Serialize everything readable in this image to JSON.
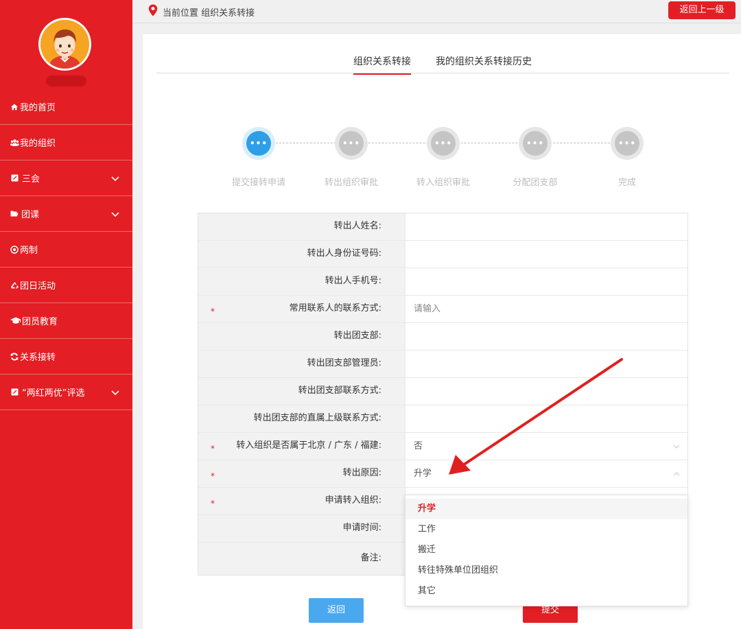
{
  "sidebar": {
    "items": [
      {
        "label": "我的首页",
        "icon": "home-icon",
        "has_chevron": false
      },
      {
        "label": "我的组织",
        "icon": "users-icon",
        "has_chevron": false
      },
      {
        "label": "三会",
        "icon": "edit-icon",
        "has_chevron": true
      },
      {
        "label": "团课",
        "icon": "folder-icon",
        "has_chevron": true
      },
      {
        "label": "两制",
        "icon": "target-icon",
        "has_chevron": false
      },
      {
        "label": "团日活动",
        "icon": "recycle-icon",
        "has_chevron": false
      },
      {
        "label": "团员教育",
        "icon": "graduation-cap-icon",
        "has_chevron": false
      },
      {
        "label": "关系接转",
        "icon": "refresh-icon",
        "has_chevron": false
      },
      {
        "label": "“两红两优”评选",
        "icon": "edit-icon",
        "has_chevron": true
      }
    ]
  },
  "topbar": {
    "location": "当前位置 组织关系转接",
    "back_button": "返回上一级"
  },
  "tabs": [
    {
      "label": "组织关系转接",
      "active": true
    },
    {
      "label": "我的组织关系转接历史",
      "active": false
    }
  ],
  "steps": [
    {
      "label": "提交接转申请",
      "active": true
    },
    {
      "label": "转出组织审批",
      "active": false
    },
    {
      "label": "转入组织审批",
      "active": false
    },
    {
      "label": "分配团支部",
      "active": false
    },
    {
      "label": "完成",
      "active": false
    }
  ],
  "step_circle_text": "•••",
  "form": {
    "required_mark": "*",
    "rows": [
      {
        "label": "转出人姓名:",
        "value": "",
        "required": false
      },
      {
        "label": "转出人身份证号码:",
        "value": "",
        "required": false
      },
      {
        "label": "转出人手机号:",
        "value": "",
        "required": false
      },
      {
        "label": "常用联系人的联系方式:",
        "value": "",
        "placeholder": "请输入",
        "required": true
      },
      {
        "label": "转出团支部:",
        "value": "",
        "required": false
      },
      {
        "label": "转出团支部管理员:",
        "value": "",
        "required": false
      },
      {
        "label": "转出团支部联系方式:",
        "value": "",
        "required": false
      },
      {
        "label": "转出团支部的直属上级联系方式:",
        "value": "",
        "required": false
      },
      {
        "label": "转入组织是否属于北京 / 广东 / 福建:",
        "value": "否",
        "required": true,
        "select": "down"
      },
      {
        "label": "转出原因:",
        "value": "升学",
        "required": true,
        "select": "up"
      },
      {
        "label": "申请转入组织:",
        "value": "",
        "required": true
      },
      {
        "label": "申请时间:",
        "value": "",
        "required": false
      },
      {
        "label": "备注:",
        "value": "",
        "required": false
      }
    ]
  },
  "dropdown": {
    "options": [
      "升学",
      "工作",
      "搬迁",
      "转往特殊单位团组织",
      "其它"
    ],
    "selected": "升学"
  },
  "buttons": {
    "back": "返回",
    "submit": "提交"
  },
  "colors": {
    "brand_red": "#e31e24",
    "step_active": "#2e9fe6",
    "back_button": "#4aa8ef"
  }
}
